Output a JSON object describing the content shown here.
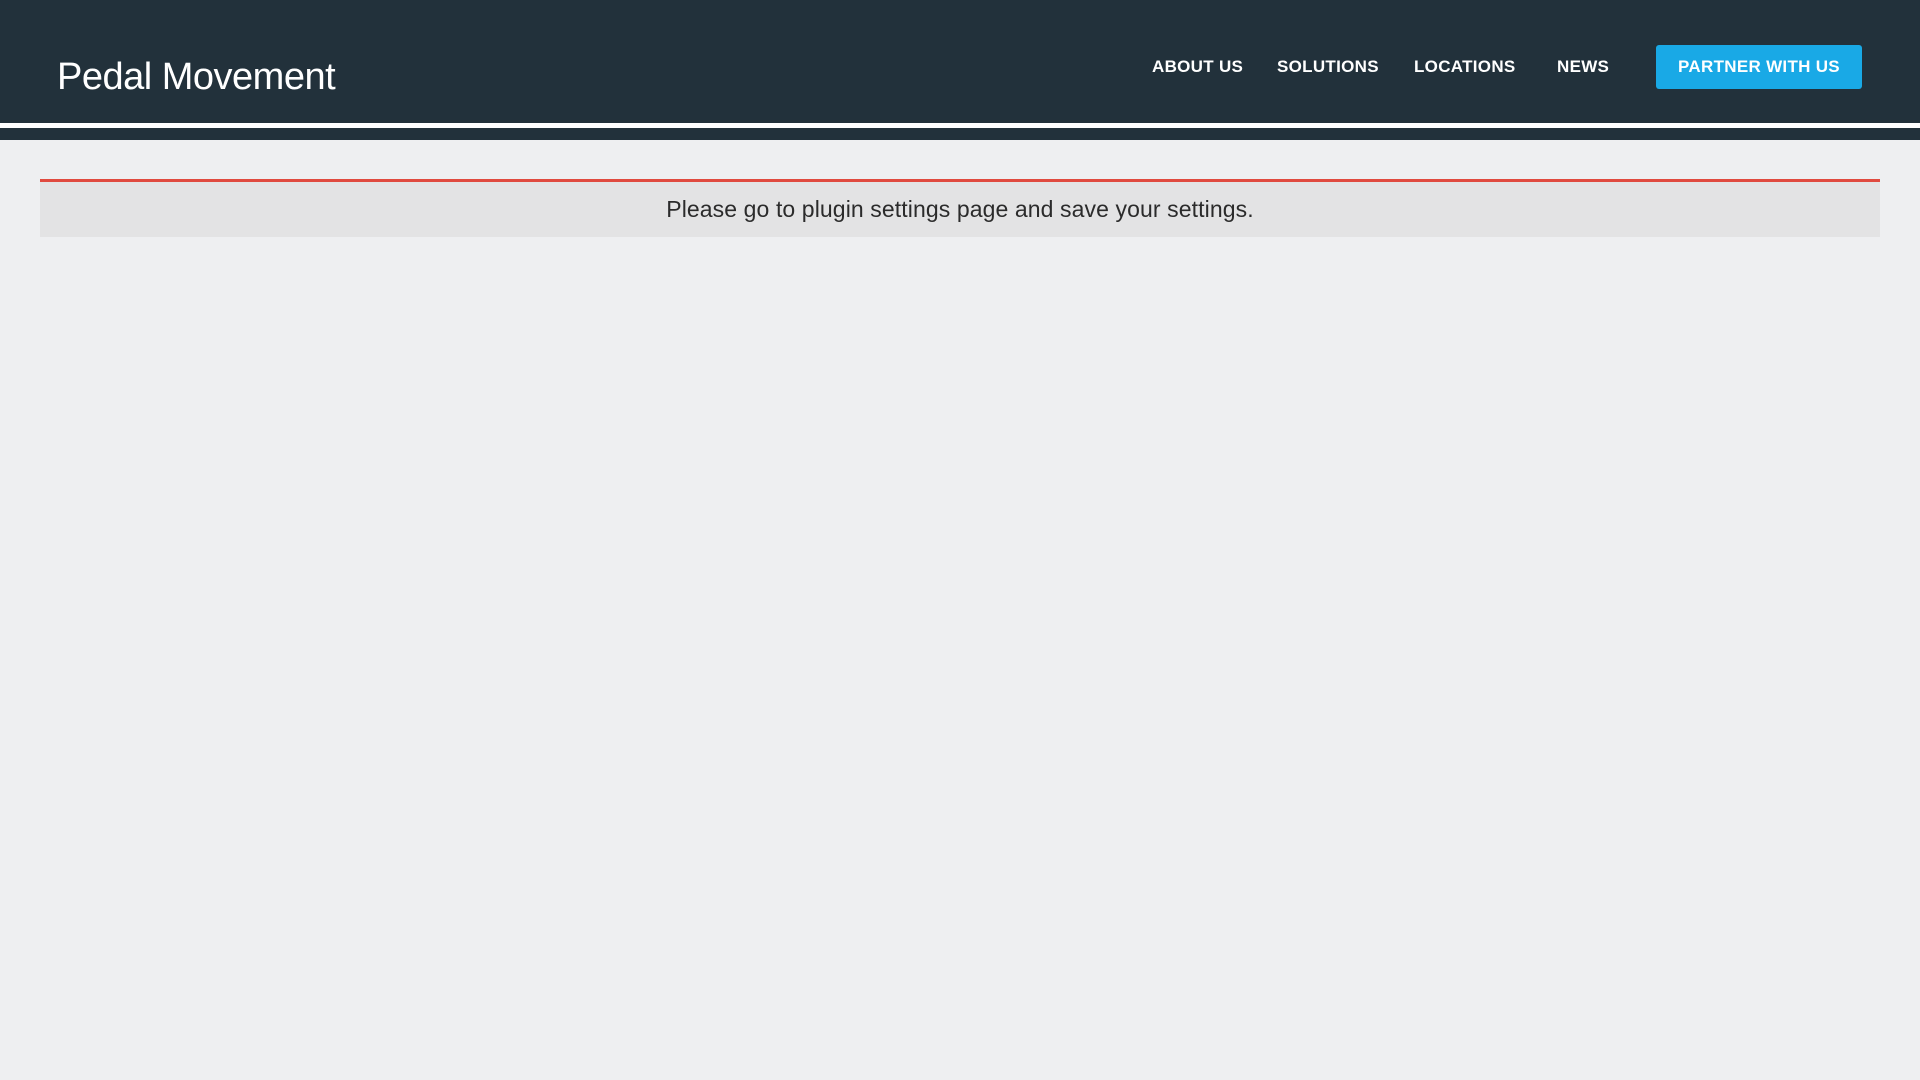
{
  "brand": {
    "name": "Pedal Movement",
    "logo_icon": "cyclist-icon"
  },
  "nav": {
    "items": [
      {
        "label": "ABOUT US"
      },
      {
        "label": "SOLUTIONS"
      },
      {
        "label": "LOCATIONS"
      },
      {
        "label": "NEWS"
      }
    ],
    "cta_label": "PARTNER WITH US"
  },
  "notice": {
    "message": "Please go to plugin settings page and save your settings."
  },
  "colors": {
    "header_bg": "#22313b",
    "cta_bg": "#19a9e6",
    "page_bg": "#eeeff1",
    "notice_bg": "#e3e3e4",
    "notice_border": "#e04a3f"
  }
}
